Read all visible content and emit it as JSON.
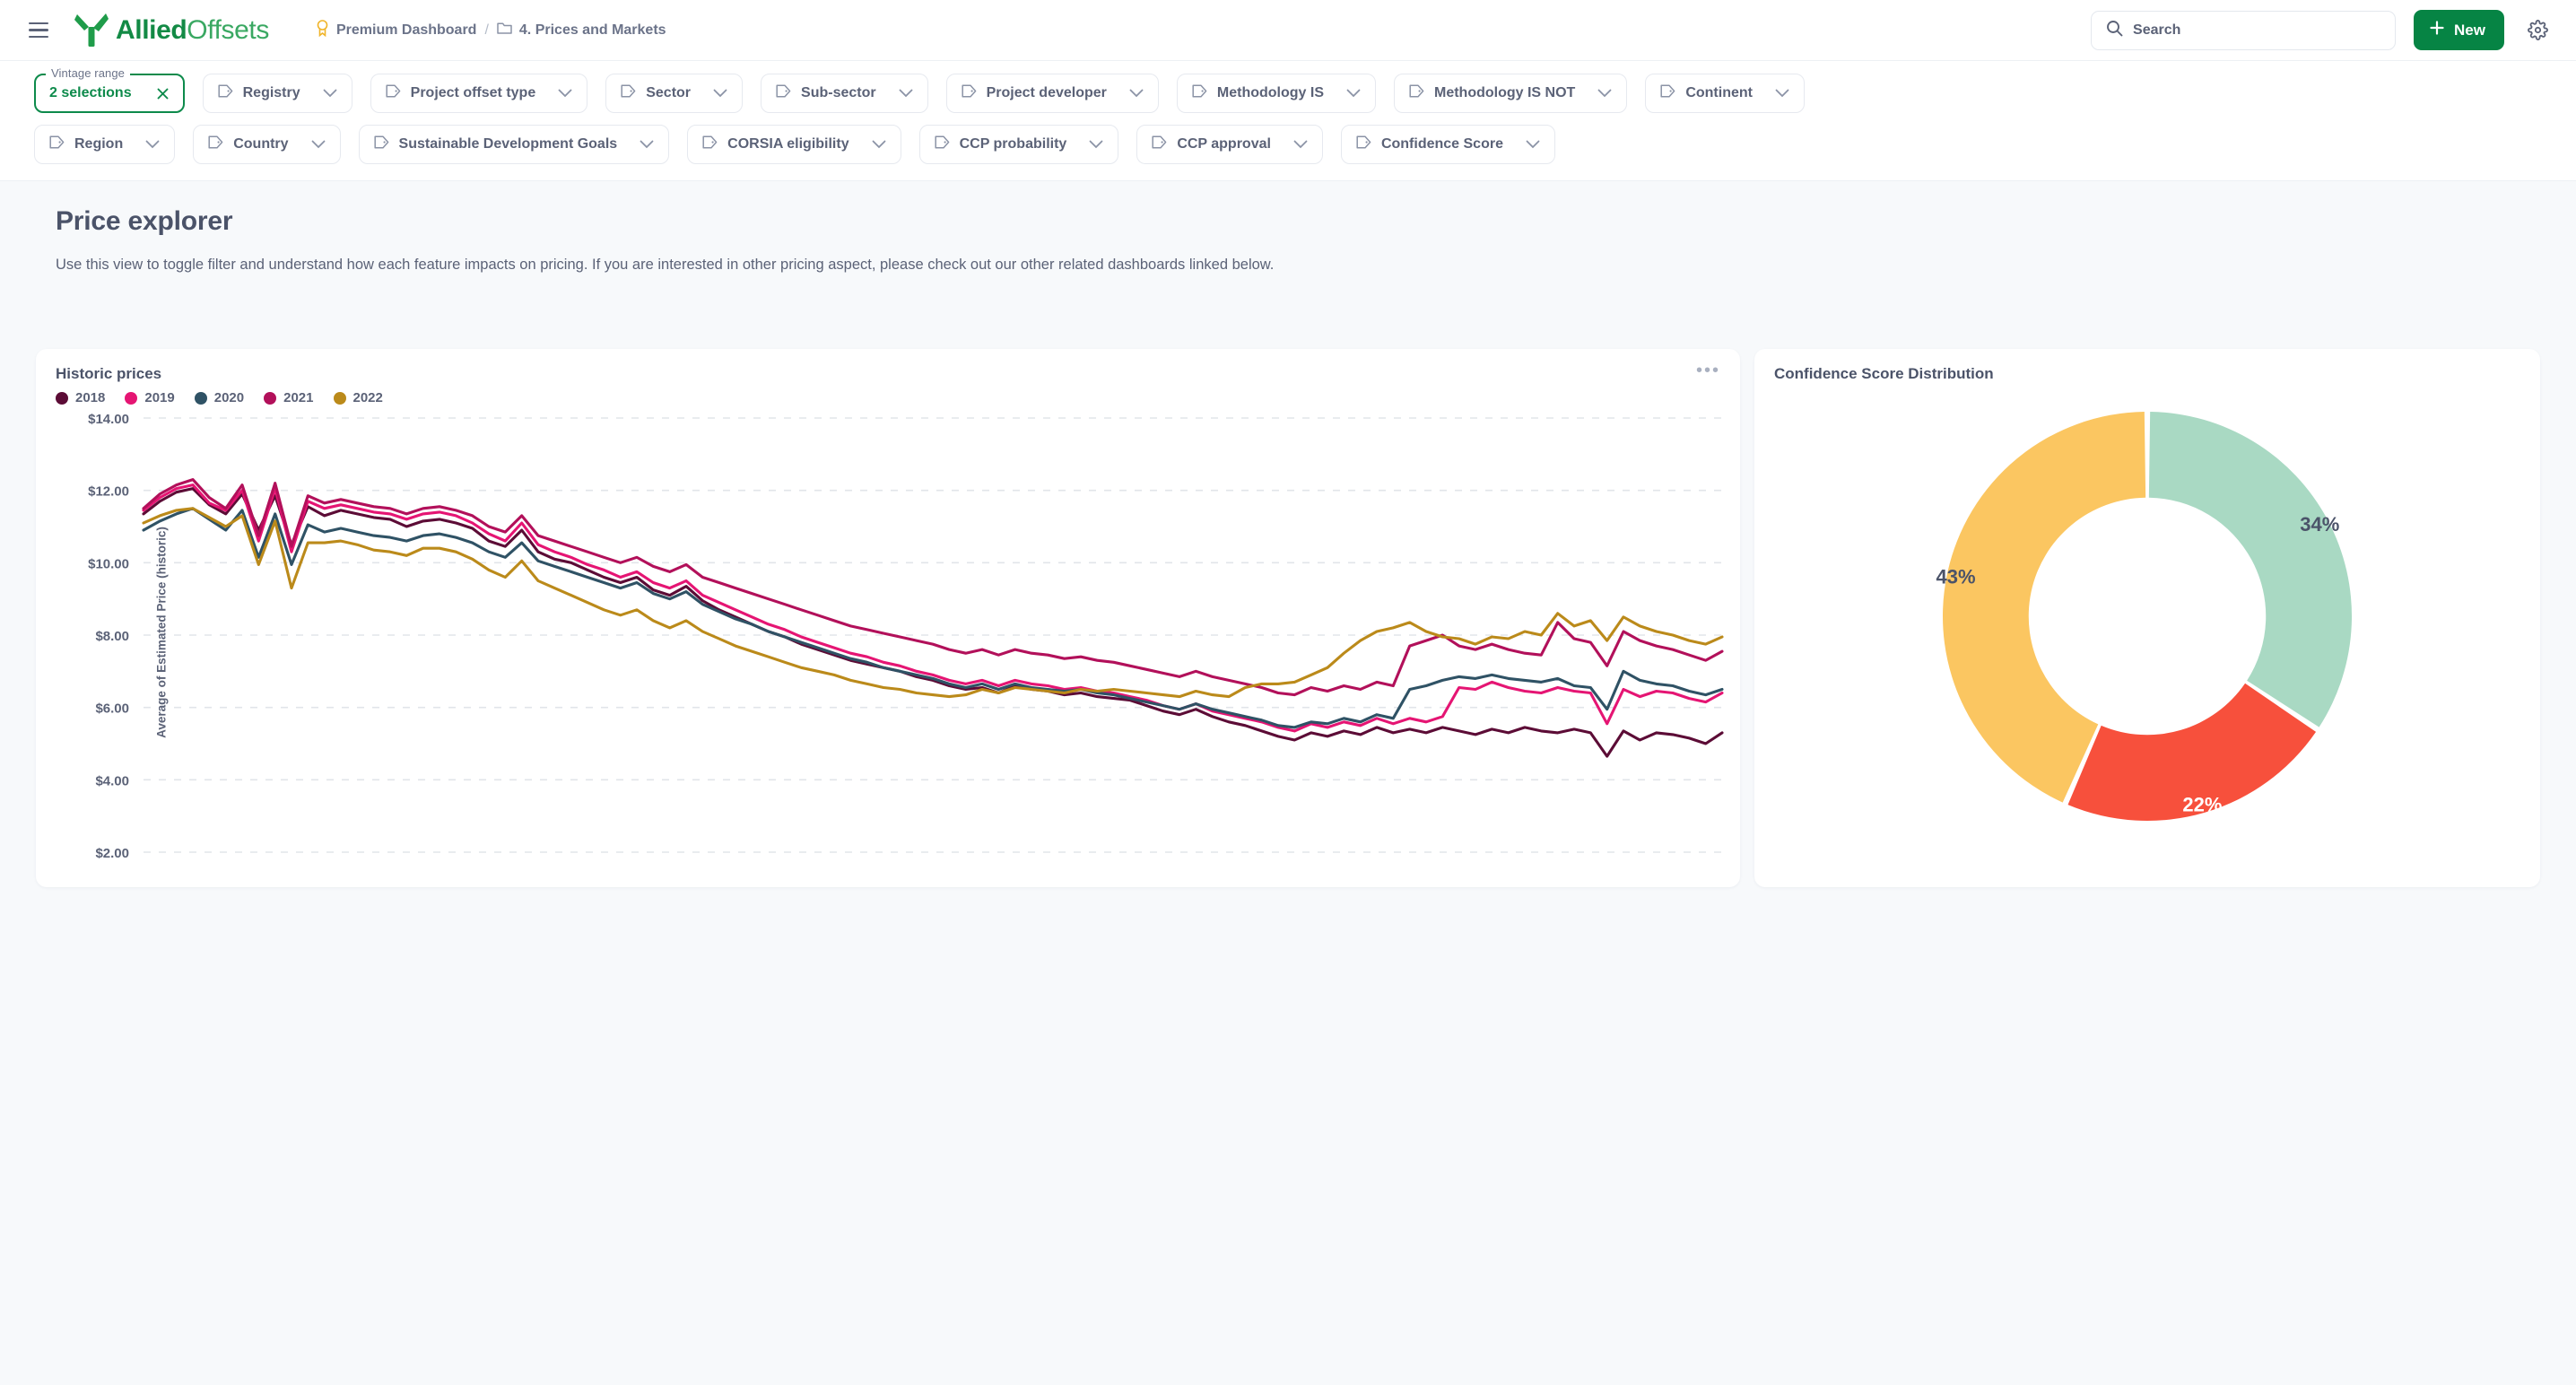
{
  "header": {
    "menu_icon": "hamburger-icon",
    "brand": {
      "part1": "Allied",
      "part2": "Offsets",
      "logo_icon": "alliedoffsets-logo-icon"
    },
    "breadcrumb": [
      {
        "icon": "premium-badge-icon",
        "label": "Premium Dashboard"
      },
      {
        "icon": "folder-icon",
        "label": "4. Prices and Markets"
      }
    ],
    "breadcrumb_separator": "/",
    "search": {
      "icon": "search-icon",
      "placeholder": "Search",
      "value": "Search"
    },
    "new_button": {
      "icon": "plus-icon",
      "label": "New"
    },
    "settings_icon": "gear-icon"
  },
  "filters": {
    "active": {
      "legend": "Vintage range",
      "value": "2 selections",
      "clear_icon": "close-icon"
    },
    "row1": [
      "Registry",
      "Project offset type",
      "Sector",
      "Sub-sector",
      "Project developer",
      "Methodology IS",
      "Methodology IS NOT",
      "Continent"
    ],
    "row2": [
      "Region",
      "Country",
      "Sustainable Development Goals",
      "CORSIA eligibility",
      "CCP probability",
      "CCP approval",
      "Confidence Score"
    ],
    "tag_icon": "tag-icon",
    "chevron_icon": "chevron-down-icon"
  },
  "page": {
    "title": "Price explorer",
    "description": "Use this view to toggle filter and understand how each feature impacts on pricing. If you are interested in other pricing aspect, please check out our other related dashboards linked below."
  },
  "cards": {
    "left": {
      "title": "Historic prices",
      "menu_icon": "more-options-icon"
    },
    "right": {
      "title": "Confidence Score Distribution"
    }
  },
  "chart_data": [
    {
      "type": "line",
      "title": "Historic prices",
      "xlabel": "",
      "ylabel": "Average of Estimated Price (historic)",
      "ylim": [
        2.0,
        14.0
      ],
      "ytick_labels": [
        "$14.00",
        "$12.00",
        "$10.00",
        "$8.00",
        "$6.00",
        "$4.00",
        "$2.00"
      ],
      "ytick_values": [
        14,
        12,
        10,
        8,
        6,
        4,
        2
      ],
      "grid": true,
      "legend_position": "top-left",
      "colors": {
        "2018": "#5c0c36",
        "2019": "#e51573",
        "2020": "#2f5265",
        "2021": "#b2105a",
        "2022": "#bb8a1a"
      },
      "series": [
        {
          "name": "2018",
          "color": "#5c0c36",
          "values": [
            11.35,
            11.7,
            11.95,
            12.05,
            11.6,
            11.35,
            11.9,
            10.9,
            11.85,
            10.5,
            11.55,
            11.3,
            11.45,
            11.35,
            11.25,
            11.2,
            11.0,
            11.15,
            11.2,
            11.1,
            10.95,
            10.6,
            10.45,
            10.9,
            10.3,
            10.1,
            10.0,
            9.8,
            9.6,
            9.45,
            9.6,
            9.25,
            9.1,
            9.35,
            8.95,
            8.7,
            8.5,
            8.3,
            8.1,
            7.95,
            7.75,
            7.6,
            7.45,
            7.3,
            7.2,
            7.1,
            7.0,
            6.85,
            6.75,
            6.6,
            6.5,
            6.55,
            6.4,
            6.6,
            6.5,
            6.45,
            6.35,
            6.4,
            6.3,
            6.25,
            6.2,
            6.05,
            5.9,
            5.8,
            5.95,
            5.75,
            5.6,
            5.5,
            5.35,
            5.2,
            5.1,
            5.3,
            5.2,
            5.35,
            5.25,
            5.45,
            5.3,
            5.4,
            5.3,
            5.45,
            5.35,
            5.25,
            5.4,
            5.3,
            5.45,
            5.35,
            5.3,
            5.4,
            5.3,
            4.65,
            5.35,
            5.1,
            5.3,
            5.25,
            5.15,
            5.0,
            5.3
          ]
        },
        {
          "name": "2019",
          "color": "#e51573",
          "values": [
            11.45,
            11.8,
            12.05,
            12.15,
            11.65,
            11.45,
            12.0,
            10.6,
            12.05,
            10.3,
            11.7,
            11.5,
            11.6,
            11.5,
            11.4,
            11.35,
            11.2,
            11.35,
            11.4,
            11.3,
            11.1,
            10.8,
            10.6,
            11.1,
            10.5,
            10.3,
            10.15,
            9.95,
            9.8,
            9.6,
            9.75,
            9.45,
            9.3,
            9.5,
            9.1,
            8.9,
            8.7,
            8.5,
            8.3,
            8.15,
            7.95,
            7.8,
            7.65,
            7.5,
            7.4,
            7.25,
            7.15,
            7.0,
            6.9,
            6.75,
            6.65,
            6.75,
            6.6,
            6.75,
            6.65,
            6.6,
            6.5,
            6.55,
            6.45,
            6.4,
            6.3,
            6.2,
            6.05,
            5.95,
            6.1,
            5.9,
            5.8,
            5.7,
            5.6,
            5.45,
            5.35,
            5.55,
            5.45,
            5.6,
            5.5,
            5.7,
            5.55,
            5.7,
            5.6,
            5.75,
            6.55,
            6.5,
            6.7,
            6.55,
            6.45,
            6.4,
            6.55,
            6.45,
            6.4,
            5.55,
            6.5,
            6.3,
            6.45,
            6.4,
            6.25,
            6.15,
            6.4
          ]
        },
        {
          "name": "2020",
          "color": "#2f5265",
          "values": [
            10.9,
            11.15,
            11.35,
            11.5,
            11.2,
            10.9,
            11.45,
            10.15,
            11.35,
            9.95,
            11.05,
            10.85,
            10.95,
            10.85,
            10.75,
            10.7,
            10.6,
            10.75,
            10.8,
            10.7,
            10.55,
            10.3,
            10.15,
            10.55,
            10.05,
            9.9,
            9.75,
            9.6,
            9.45,
            9.3,
            9.45,
            9.15,
            9.0,
            9.2,
            8.85,
            8.65,
            8.45,
            8.3,
            8.1,
            7.95,
            7.8,
            7.65,
            7.5,
            7.35,
            7.25,
            7.1,
            7.0,
            6.9,
            6.8,
            6.65,
            6.55,
            6.65,
            6.5,
            6.65,
            6.55,
            6.5,
            6.45,
            6.5,
            6.4,
            6.35,
            6.25,
            6.15,
            6.05,
            5.95,
            6.1,
            5.95,
            5.85,
            5.75,
            5.65,
            5.5,
            5.45,
            5.6,
            5.55,
            5.7,
            5.6,
            5.8,
            5.7,
            6.5,
            6.6,
            6.75,
            6.85,
            6.8,
            6.9,
            6.8,
            6.75,
            6.7,
            6.8,
            6.6,
            6.55,
            5.95,
            7.0,
            6.75,
            6.65,
            6.6,
            6.45,
            6.35,
            6.5
          ]
        },
        {
          "name": "2021",
          "color": "#b2105a",
          "values": [
            11.5,
            11.9,
            12.15,
            12.3,
            11.8,
            11.5,
            12.15,
            10.75,
            12.2,
            10.45,
            11.85,
            11.65,
            11.75,
            11.65,
            11.55,
            11.5,
            11.35,
            11.5,
            11.55,
            11.45,
            11.3,
            11.0,
            10.85,
            11.3,
            10.75,
            10.6,
            10.45,
            10.3,
            10.15,
            10.0,
            10.15,
            9.9,
            9.75,
            9.95,
            9.6,
            9.45,
            9.3,
            9.15,
            9.0,
            8.85,
            8.7,
            8.55,
            8.4,
            8.25,
            8.15,
            8.05,
            7.95,
            7.85,
            7.75,
            7.6,
            7.5,
            7.6,
            7.45,
            7.6,
            7.5,
            7.45,
            7.35,
            7.4,
            7.3,
            7.25,
            7.15,
            7.05,
            6.95,
            6.85,
            7.0,
            6.85,
            6.75,
            6.65,
            6.55,
            6.4,
            6.35,
            6.55,
            6.45,
            6.6,
            6.5,
            6.7,
            6.6,
            7.7,
            7.85,
            8.0,
            7.7,
            7.6,
            7.75,
            7.6,
            7.5,
            7.45,
            8.35,
            7.9,
            7.8,
            7.15,
            8.1,
            7.85,
            7.7,
            7.6,
            7.45,
            7.3,
            7.55
          ]
        },
        {
          "name": "2022",
          "color": "#bb8a1a",
          "values": [
            11.1,
            11.3,
            11.45,
            11.5,
            11.25,
            11.0,
            11.3,
            9.95,
            11.15,
            9.3,
            10.55,
            10.55,
            10.6,
            10.5,
            10.35,
            10.3,
            10.2,
            10.4,
            10.4,
            10.3,
            10.1,
            9.8,
            9.6,
            10.05,
            9.5,
            9.3,
            9.1,
            8.9,
            8.7,
            8.55,
            8.7,
            8.4,
            8.2,
            8.4,
            8.1,
            7.9,
            7.7,
            7.55,
            7.4,
            7.25,
            7.1,
            7.0,
            6.9,
            6.75,
            6.65,
            6.55,
            6.5,
            6.4,
            6.35,
            6.3,
            6.35,
            6.5,
            6.4,
            6.55,
            6.5,
            6.45,
            6.4,
            6.5,
            6.45,
            6.5,
            6.45,
            6.4,
            6.35,
            6.3,
            6.45,
            6.35,
            6.3,
            6.55,
            6.65,
            6.65,
            6.7,
            6.9,
            7.1,
            7.5,
            7.85,
            8.1,
            8.2,
            8.35,
            8.1,
            7.95,
            7.9,
            7.75,
            7.95,
            7.9,
            8.1,
            8.0,
            8.6,
            8.25,
            8.4,
            7.85,
            8.5,
            8.25,
            8.1,
            8.0,
            7.85,
            7.75,
            7.95
          ]
        }
      ]
    },
    {
      "type": "pie",
      "subtype": "donut",
      "title": "Confidence Score Distribution",
      "labels": [
        "34%",
        "22%",
        "43%"
      ],
      "values": [
        34,
        22,
        43
      ],
      "colors": [
        "#a9d9c3",
        "#f7503c",
        "#fbc661"
      ],
      "label_colors": [
        "#4b5369",
        "#ffffff",
        "#4b5369"
      ],
      "legend_position": "none",
      "inner_radius_ratio": 0.58
    }
  ]
}
